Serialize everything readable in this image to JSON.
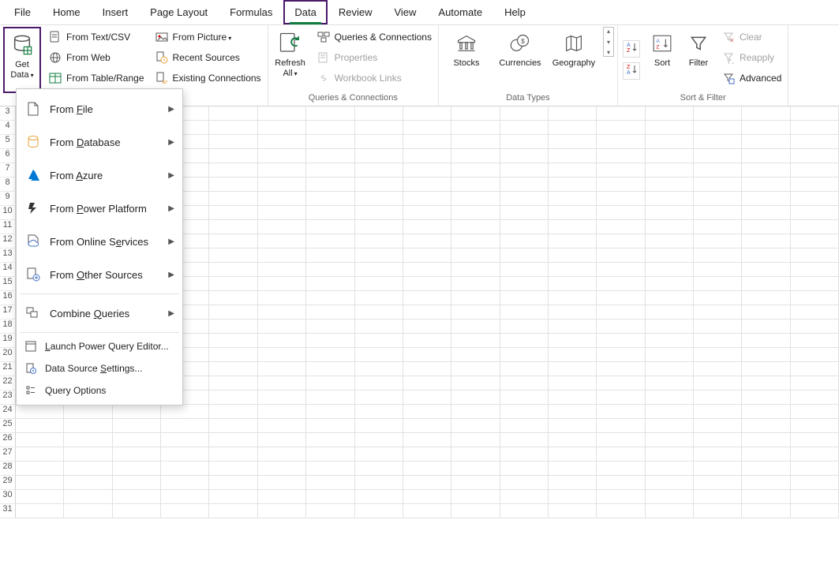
{
  "menubar": {
    "file": "File",
    "home": "Home",
    "insert": "Insert",
    "page_layout": "Page Layout",
    "formulas": "Formulas",
    "data": "Data",
    "review": "Review",
    "view": "View",
    "automate": "Automate",
    "help": "Help"
  },
  "ribbon": {
    "get_data": "Get Data",
    "from_text_csv": "From Text/CSV",
    "from_web": "From Web",
    "from_table_range": "From Table/Range",
    "from_picture": "From Picture",
    "recent_sources": "Recent Sources",
    "existing_connections": "Existing Connections",
    "refresh_all": "Refresh All",
    "queries_connections_btn": "Queries & Connections",
    "properties": "Properties",
    "workbook_links": "Workbook Links",
    "queries_connections_group": "Queries & Connections",
    "stocks": "Stocks",
    "currencies": "Currencies",
    "geography": "Geography",
    "data_types_group": "Data Types",
    "sort": "Sort",
    "filter": "Filter",
    "clear": "Clear",
    "reapply": "Reapply",
    "advanced": "Advanced",
    "sort_filter_group": "Sort & Filter"
  },
  "dropdown": {
    "from_file": "From File",
    "from_database": "From Database",
    "from_azure": "From Azure",
    "from_power_platform": "From Power Platform",
    "from_online_services": "From Online Services",
    "from_other_sources": "From Other Sources",
    "combine_queries": "Combine Queries",
    "launch_pq_editor": "Launch Power Query Editor...",
    "data_source_settings": "Data Source Settings...",
    "query_options": "Query Options"
  },
  "grid": {
    "first_row": 3,
    "last_row": 31
  }
}
